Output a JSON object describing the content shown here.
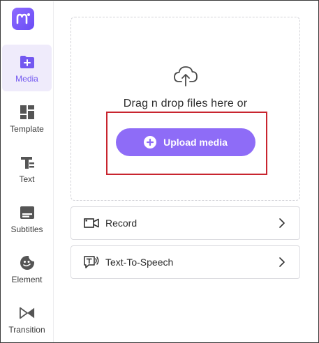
{
  "sidebar": {
    "logo_icon": "moka-logo-icon",
    "items": [
      {
        "label": "Media",
        "icon": "media-folder-icon",
        "active": true
      },
      {
        "label": "Template",
        "icon": "template-grid-icon",
        "active": false
      },
      {
        "label": "Text",
        "icon": "text-icon",
        "active": false
      },
      {
        "label": "Subtitles",
        "icon": "subtitles-icon",
        "active": false
      },
      {
        "label": "Element",
        "icon": "element-icon",
        "active": false
      },
      {
        "label": "Transition",
        "icon": "transition-icon",
        "active": false
      }
    ]
  },
  "upload": {
    "drag_text": "Drag n drop files here or",
    "button_label": "Upload media",
    "cloud_icon": "cloud-upload-icon"
  },
  "actions": [
    {
      "label": "Record",
      "icon": "camera-icon"
    },
    {
      "label": "Text-To-Speech",
      "icon": "text-to-speech-icon"
    }
  ],
  "colors": {
    "accent": "#8e6cf7",
    "active_bg": "#efebfb",
    "highlight": "#c8252f"
  }
}
